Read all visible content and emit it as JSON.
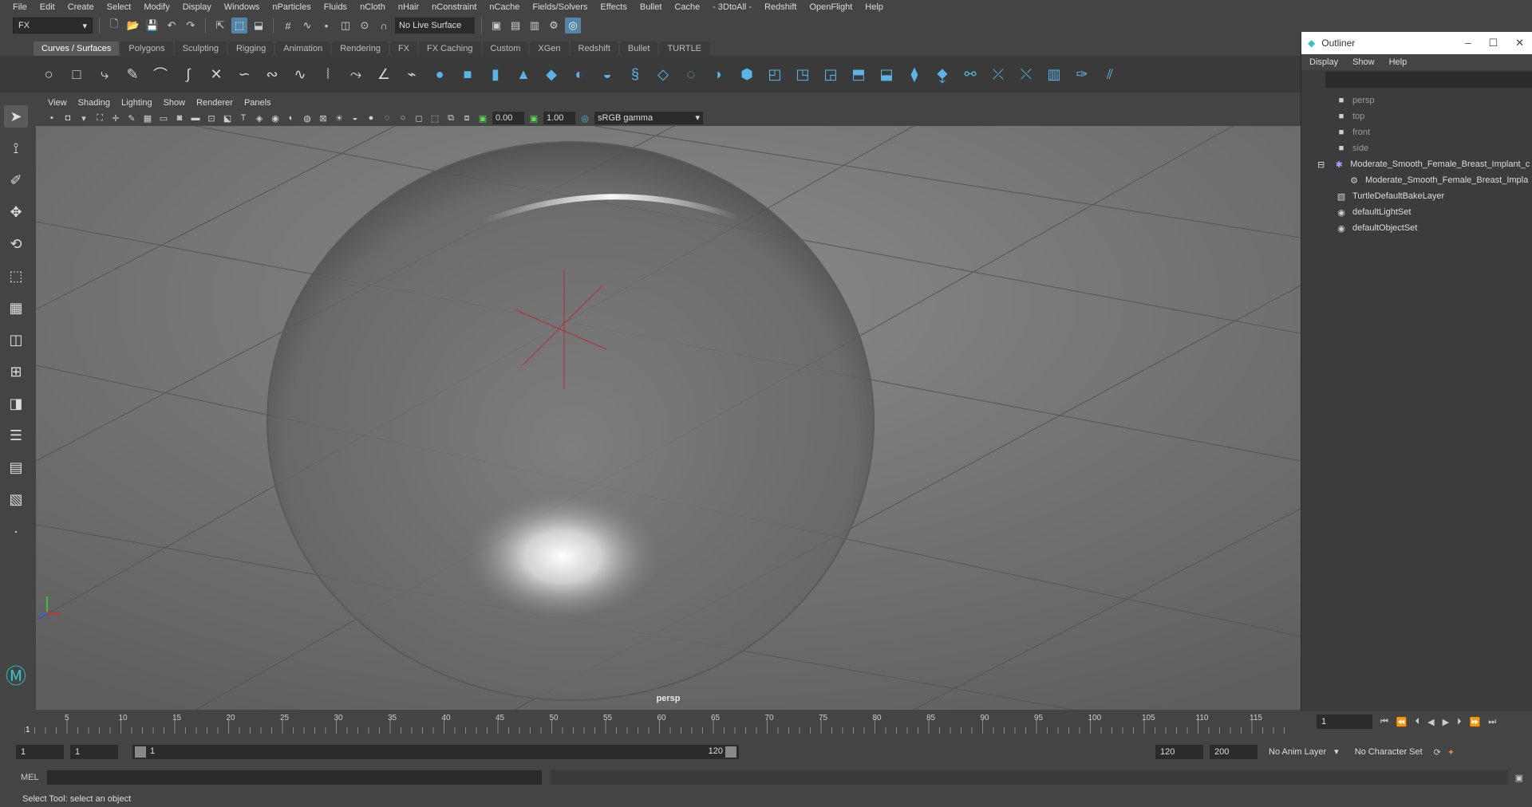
{
  "menus": [
    "File",
    "Edit",
    "Create",
    "Select",
    "Modify",
    "Display",
    "Windows",
    "nParticles",
    "Fluids",
    "nCloth",
    "nHair",
    "nConstraint",
    "nCache",
    "Fields/Solvers",
    "Effects",
    "Bullet",
    "Cache",
    "- 3DtoAll -",
    "Redshift",
    "OpenFlight",
    "Help"
  ],
  "status_line": {
    "mode": "FX",
    "live_surface": "No Live Surface"
  },
  "shelf": {
    "tabs": [
      "Curves / Surfaces",
      "Polygons",
      "Sculpting",
      "Rigging",
      "Animation",
      "Rendering",
      "FX",
      "FX Caching",
      "Custom",
      "XGen",
      "Redshift",
      "Bullet",
      "TURTLE"
    ],
    "active_tab": "Curves / Surfaces"
  },
  "viewport": {
    "menus": [
      "View",
      "Shading",
      "Lighting",
      "Show",
      "Renderer",
      "Panels"
    ],
    "exposure": "0.00",
    "gamma": "1.00",
    "color_space": "sRGB gamma",
    "camera_label": "persp"
  },
  "outliner": {
    "title": "Outliner",
    "menus": [
      "Display",
      "Show",
      "Help"
    ],
    "items": [
      {
        "label": "persp",
        "icon": "camera-icon",
        "dim": true
      },
      {
        "label": "top",
        "icon": "camera-icon",
        "dim": true
      },
      {
        "label": "front",
        "icon": "camera-icon",
        "dim": true
      },
      {
        "label": "side",
        "icon": "camera-icon",
        "dim": true
      },
      {
        "label": "Moderate_Smooth_Female_Breast_Implant_c",
        "icon": "transform-icon",
        "dim": false
      },
      {
        "label": "Moderate_Smooth_Female_Breast_Impla",
        "icon": "mesh-icon",
        "dim": false
      },
      {
        "label": "TurtleDefaultBakeLayer",
        "icon": "bake-layer-icon",
        "dim": false
      },
      {
        "label": "defaultLightSet",
        "icon": "set-icon",
        "dim": false
      },
      {
        "label": "defaultObjectSet",
        "icon": "set-icon",
        "dim": false
      }
    ]
  },
  "timeline": {
    "ticks": [
      "5",
      "10",
      "15",
      "20",
      "25",
      "30",
      "35",
      "40",
      "45",
      "50",
      "55",
      "60",
      "65",
      "70",
      "75",
      "80",
      "85",
      "90",
      "95",
      "100",
      "105",
      "110",
      "115"
    ],
    "current_frame": "1",
    "current_frame_field": "1"
  },
  "range": {
    "start": "1",
    "anim_start": "1",
    "range_start_label": "1",
    "range_end_label": "120",
    "end": "120",
    "anim_end": "200",
    "anim_layer": "No Anim Layer",
    "character_set": "No Character Set"
  },
  "command_line": {
    "label": "MEL"
  },
  "help_line": "Select Tool: select an object"
}
